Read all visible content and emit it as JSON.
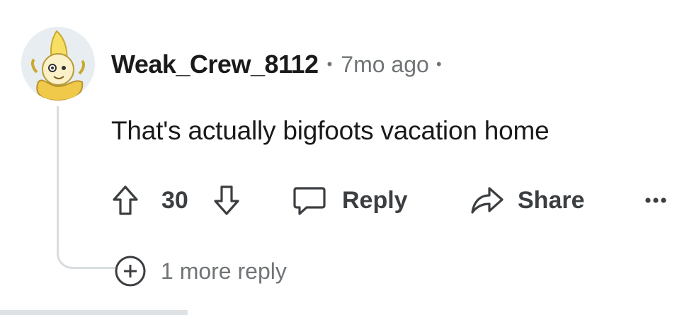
{
  "comment": {
    "username": "Weak_Crew_8112",
    "separator": "•",
    "time": "7mo ago",
    "body": "That's actually bigfoots vacation home",
    "score": "30",
    "reply_label": "Reply",
    "share_label": "Share",
    "more_label": "•••",
    "more_replies_label": "1 more reply"
  },
  "icons": {
    "upvote": "arrow-up-outline",
    "downvote": "arrow-down-outline",
    "reply": "speech-bubble",
    "share": "share-arrow",
    "expand": "plus-circle"
  },
  "colors": {
    "text": "#1a1a1b",
    "muted": "#707476",
    "icon": "#3c3f42",
    "thread_line": "#d9dde0"
  }
}
